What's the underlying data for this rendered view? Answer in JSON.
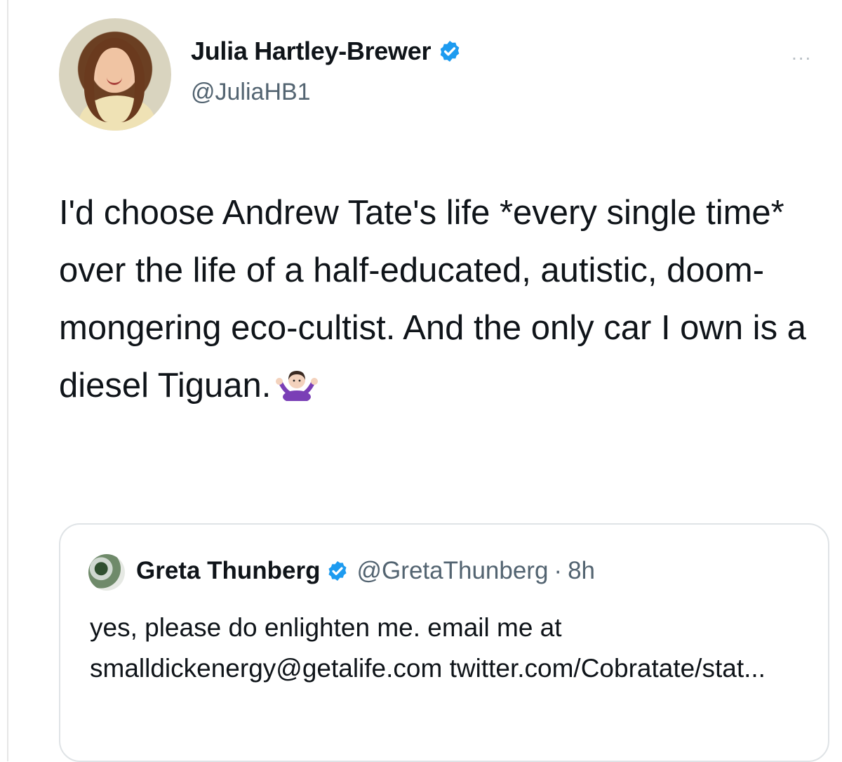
{
  "tweet": {
    "author": {
      "display_name": "Julia Hartley-Brewer",
      "handle": "@JuliaHB1",
      "verified": true,
      "avatar_icon": "profile-photo-avatar"
    },
    "more_icon": "ellipsis-icon",
    "more_label": "...",
    "text": "I'd choose Andrew Tate's life *every single time* over the life of a half-educated, autistic, doom-mongering eco-cultist. And the only car I own is a diesel Tiguan.",
    "emoji": "shrug-emoji"
  },
  "quoted_tweet": {
    "author": {
      "display_name": "Greta Thunberg",
      "handle": "@GretaThunberg",
      "verified": true,
      "avatar_icon": "profile-photo-avatar"
    },
    "separator": "·",
    "time": "8h",
    "text": "yes, please do enlighten me. email me at smalldickenergy@getalife.com twitter.com/Cobratate/stat..."
  },
  "colors": {
    "verified_badge": "#1d9bf0",
    "text_primary": "#0f1419",
    "text_secondary": "#536471",
    "border": "#dfe3e6"
  }
}
